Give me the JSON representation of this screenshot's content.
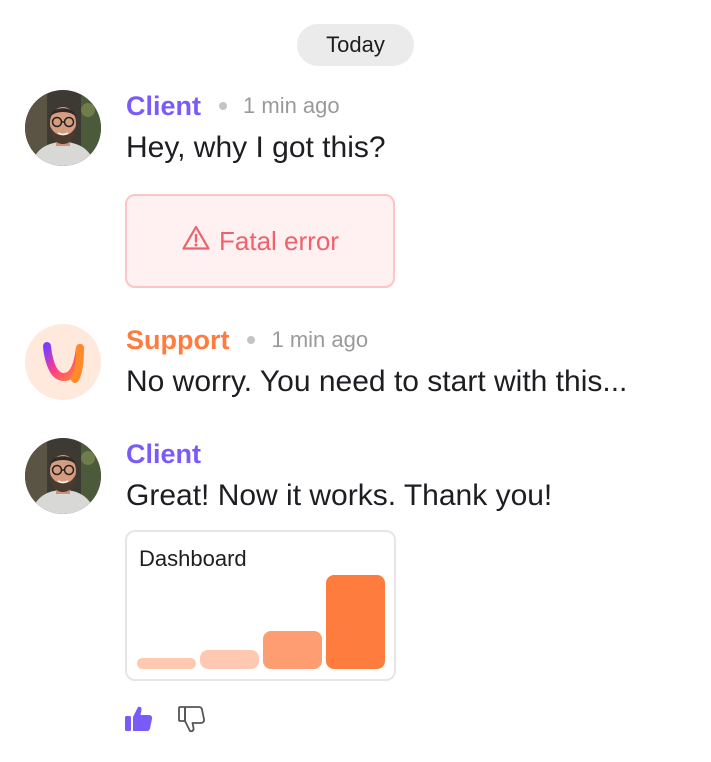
{
  "date_separator": "Today",
  "messages": [
    {
      "author": "Client",
      "role": "client",
      "time": "1 min ago",
      "text": "Hey, why I got this?",
      "attachment": {
        "type": "error",
        "label": "Fatal error",
        "icon": "warning-triangle-icon"
      }
    },
    {
      "author": "Support",
      "role": "support",
      "time": "1 min ago",
      "text": "No worry. You need to start with this...",
      "logo": "support-logo-icon"
    },
    {
      "author": "Client",
      "role": "client",
      "text": "Great! Now it works. Thank you!",
      "attachment": {
        "type": "dashboard",
        "title": "Dashboard",
        "bars": [
          0.1,
          0.2,
          0.4,
          1.0
        ]
      }
    }
  ],
  "reactions": {
    "like_icon": "thumbs-up-icon",
    "dislike_icon": "thumbs-down-icon",
    "liked": true
  },
  "colors": {
    "client": "#7a5af8",
    "support": "#ff7c3f",
    "error": "#f0626b",
    "bar_colors": [
      "#ffc9b1",
      "#ffc9b1",
      "#ff9d72",
      "#ff7c3f"
    ]
  }
}
